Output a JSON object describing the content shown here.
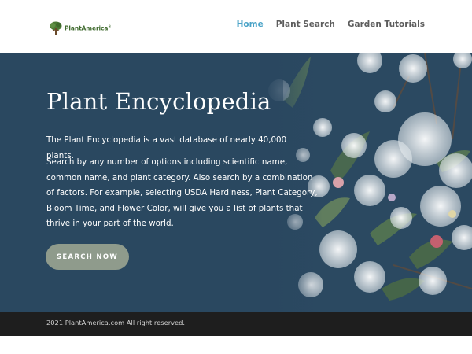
{
  "header": {
    "logo_text": "PlantAmerica",
    "logo_mark": "®",
    "nav": [
      {
        "label": "Home",
        "active": true
      },
      {
        "label": "Plant Search",
        "active": false
      },
      {
        "label": "Garden Tutorials",
        "active": false
      }
    ]
  },
  "hero": {
    "title": "Plant Encyclopedia",
    "paragraph_1": "The Plant Encyclopedia is a vast database of nearly 40,000 plants.",
    "paragraph_2": "Search by any number of options including scientific name, common name, and plant category. Also search by a combination of factors. For example, selecting USDA Hardiness, Plant Category, Bloom Time, and Flower Color, will give you a list of plants that thrive in your part of the world.",
    "cta_label": "SEARCH NOW"
  },
  "footer": {
    "copyright": "2021 PlantAmerica.com All right reserved."
  },
  "colors": {
    "nav_active": "#4aa3c7",
    "nav_default": "#5c5c5c",
    "hero_bg": "#2a4760",
    "cta_bg": "#8f9b8c",
    "footer_bg": "#1e1e1e",
    "logo_green": "#3f6a2e"
  },
  "icons": {
    "logo": "tree-logo-icon"
  }
}
